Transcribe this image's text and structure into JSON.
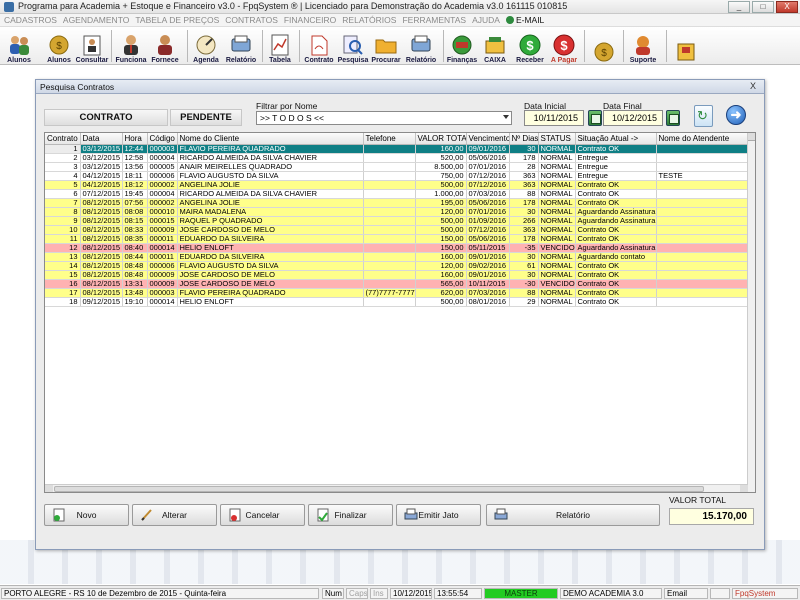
{
  "window": {
    "title": "Programa para Academia + Estoque e Financeiro v3.0 - FpqSystem ® | Licenciado para  Demonstração do Academia v3.0 161115 010815",
    "minimize": "_",
    "maximize": "□",
    "close": "X"
  },
  "menu": [
    "CADASTROS",
    "AGENDAMENTO",
    "TABELA DE PREÇOS",
    "CONTRATOS",
    "FINANCEIRO",
    "RELATÓRIOS",
    "FERRAMENTAS",
    "AJUDA"
  ],
  "menu_email": "E-MAIL",
  "toolbar": {
    "alunos": "Alunos",
    "alunos2": "Alunos",
    "consultar": "Consultar",
    "funciona": "Funciona",
    "fornece": "Fornece",
    "agenda": "Agenda",
    "relatorio1": "Relatório",
    "tabela": "Tabela",
    "contrato": "Contrato",
    "pesquisa": "Pesquisa",
    "procurar": "Procurar",
    "relatorio2": "Relatório",
    "financas": "Finanças",
    "caixa": "CAIXA",
    "receber": "Receber",
    "apagar": "A Pagar",
    "suporte": "Suporte"
  },
  "dialog": {
    "title": "Pesquisa Contratos",
    "close": "X",
    "status_contrato": "CONTRATO",
    "status_pendente": "PENDENTE",
    "filter_label": "Filtrar por Nome",
    "filter_value": ">> T O D O S <<",
    "date_start_label": "Data Inicial",
    "date_start": "10/11/2015",
    "date_end_label": "Data Final",
    "date_end": "10/12/2015",
    "go": "➜"
  },
  "table": {
    "headers": [
      "Contrato",
      "Data",
      "Hora",
      "Código",
      "Nome do Cliente",
      "Telefone",
      "VALOR TOTAL",
      "Vencimento",
      "Nº Dias",
      "STATUS",
      "Situação Atual ->",
      "Nome do Atendente"
    ],
    "rows": [
      {
        "style": "sel",
        "cells": [
          "1",
          "03/12/2015",
          "12:44",
          "000003",
          "FLAVIO PEREIRA QUADRADO",
          "",
          "160,00",
          "09/01/2016",
          "30",
          "NORMAL",
          "Contrato OK",
          ""
        ]
      },
      {
        "style": "white",
        "cells": [
          "2",
          "03/12/2015",
          "12:58",
          "000004",
          "RICARDO ALMEIDA DA SILVA CHAVIER",
          "",
          "520,00",
          "05/06/2016",
          "178",
          "NORMAL",
          "Entregue",
          ""
        ]
      },
      {
        "style": "white",
        "cells": [
          "3",
          "03/12/2015",
          "13:56",
          "000005",
          "ANAIR MEIRELLES QUADRADO",
          "",
          "8.500,00",
          "07/01/2016",
          "28",
          "NORMAL",
          "Entregue",
          ""
        ]
      },
      {
        "style": "white",
        "cells": [
          "4",
          "04/12/2015",
          "18:11",
          "000006",
          "FLAVIO AUGUSTO DA SILVA",
          "",
          "750,00",
          "07/12/2016",
          "363",
          "NORMAL",
          "Entregue",
          "TESTE"
        ]
      },
      {
        "style": "yellow",
        "cells": [
          "5",
          "04/12/2015",
          "18:12",
          "000002",
          "ANGELINA JOLIE",
          "",
          "500,00",
          "07/12/2016",
          "363",
          "NORMAL",
          "Contrato OK",
          ""
        ]
      },
      {
        "style": "white",
        "cells": [
          "6",
          "07/12/2015",
          "19:45",
          "000004",
          "RICARDO ALMEIDA DA SILVA CHAVIER",
          "",
          "1.000,00",
          "07/03/2016",
          "88",
          "NORMAL",
          "Contrato OK",
          ""
        ]
      },
      {
        "style": "yellow",
        "cells": [
          "7",
          "08/12/2015",
          "07:56",
          "000002",
          "ANGELINA JOLIE",
          "",
          "195,00",
          "05/06/2016",
          "178",
          "NORMAL",
          "Contrato OK",
          ""
        ]
      },
      {
        "style": "yellow",
        "cells": [
          "8",
          "08/12/2015",
          "08:08",
          "000010",
          "MAIRA MADALENA",
          "",
          "120,00",
          "07/01/2016",
          "30",
          "NORMAL",
          "Aguardando Assinatura",
          ""
        ]
      },
      {
        "style": "yellow",
        "cells": [
          "9",
          "08/12/2015",
          "08:15",
          "000015",
          "RAQUEL P QUADRADO",
          "",
          "500,00",
          "01/09/2016",
          "266",
          "NORMAL",
          "Aguardando Assinatura",
          ""
        ]
      },
      {
        "style": "yellow",
        "cells": [
          "10",
          "08/12/2015",
          "08:33",
          "000009",
          "JOSE CARDOSO DE MELO",
          "",
          "500,00",
          "07/12/2016",
          "363",
          "NORMAL",
          "Contrato OK",
          ""
        ]
      },
      {
        "style": "yellow",
        "cells": [
          "11",
          "08/12/2015",
          "08:35",
          "000011",
          "EDUARDO DA SILVEIRA",
          "",
          "150,00",
          "05/06/2016",
          "178",
          "NORMAL",
          "Contrato OK",
          ""
        ]
      },
      {
        "style": "pink",
        "cells": [
          "12",
          "08/12/2015",
          "08:40",
          "000014",
          "HELIO ENLOFT",
          "",
          "150,00",
          "05/11/2015",
          "-35",
          "VENCIDO",
          "Aguardando Assinatura",
          ""
        ]
      },
      {
        "style": "yellow",
        "cells": [
          "13",
          "08/12/2015",
          "08:44",
          "000011",
          "EDUARDO DA SILVEIRA",
          "",
          "160,00",
          "09/01/2016",
          "30",
          "NORMAL",
          "Aguardando contato",
          ""
        ]
      },
      {
        "style": "yellow",
        "cells": [
          "14",
          "08/12/2015",
          "08:48",
          "000006",
          "FLAVIO AUGUSTO DA SILVA",
          "",
          "120,00",
          "09/02/2016",
          "61",
          "NORMAL",
          "Contrato OK",
          ""
        ]
      },
      {
        "style": "yellow",
        "cells": [
          "15",
          "08/12/2015",
          "08:48",
          "000009",
          "JOSE CARDOSO DE MELO",
          "",
          "160,00",
          "09/01/2016",
          "30",
          "NORMAL",
          "Contrato OK",
          ""
        ]
      },
      {
        "style": "pink",
        "cells": [
          "16",
          "08/12/2015",
          "13:31",
          "000009",
          "JOSE CARDOSO DE MELO",
          "",
          "565,00",
          "10/11/2015",
          "-30",
          "VENCIDO",
          "Contrato OK",
          ""
        ]
      },
      {
        "style": "yellow",
        "cells": [
          "17",
          "08/12/2015",
          "13:48",
          "000003",
          "FLAVIO PEREIRA QUADRADO",
          "(77)7777-7777",
          "620,00",
          "07/03/2016",
          "88",
          "NORMAL",
          "Contrato OK",
          ""
        ]
      },
      {
        "style": "white",
        "cells": [
          "18",
          "09/12/2015",
          "19:10",
          "000014",
          "HELIO ENLOFT",
          "",
          "500,00",
          "08/01/2016",
          "29",
          "NORMAL",
          "Contrato OK",
          ""
        ]
      }
    ]
  },
  "buttons": {
    "novo": "Novo",
    "alterar": "Alterar",
    "cancelar": "Cancelar",
    "finalizar": "Finalizar",
    "emitir": "Emitir Jato",
    "relatorio": "Relatório"
  },
  "total": {
    "label": "VALOR TOTAL",
    "value": "15.170,00"
  },
  "statusbar": {
    "location": "PORTO ALEGRE - RS 10 de Dezembro de 2015 - Quinta-feira",
    "num": "Num",
    "caps": "Caps",
    "ins": "Ins",
    "date": "10/12/2015",
    "time": "13:55:54",
    "user": "MASTER",
    "edition": "DEMO ACADEMIA 3.0",
    "email": "Email",
    "brand": "FpqSystem"
  },
  "colors": {
    "selected_row": "#0f7f85",
    "yellow_row": "#ffff8a",
    "pink_row": "#ffb2b2",
    "master_green": "#22cc22"
  }
}
